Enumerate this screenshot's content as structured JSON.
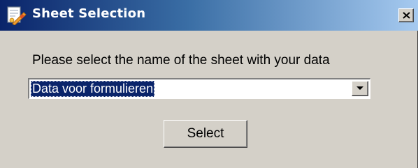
{
  "window": {
    "title": "Sheet Selection",
    "icon": "sheet-app-icon",
    "close_icon": "close-icon",
    "colors": {
      "titlebar_start": "#0a246a",
      "titlebar_end": "#a6caf0",
      "face": "#d4d0c8",
      "selection": "#0a246a"
    }
  },
  "dialog": {
    "prompt": "Please select the name of the sheet with your data",
    "sheet_select": {
      "selected_value": "Data voor formulieren",
      "arrow_icon": "chevron-down-icon"
    },
    "select_button_label": "Select"
  }
}
